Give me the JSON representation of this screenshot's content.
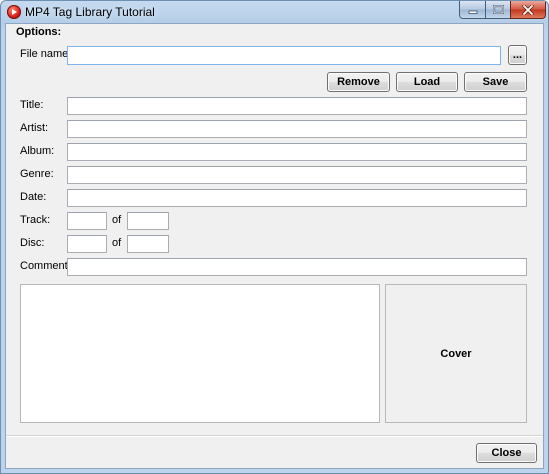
{
  "window": {
    "title": "MP4 Tag Library Tutorial",
    "minimize_icon": "minimize-icon",
    "maximize_icon": "maximize-icon",
    "close_icon": "close-icon"
  },
  "options": {
    "group_title": "Options:",
    "file_name_label": "File name:",
    "file_name_value": "",
    "browse_label": "...",
    "remove_label": "Remove",
    "load_label": "Load",
    "save_label": "Save"
  },
  "tags": {
    "title_label": "Title:",
    "title_value": "",
    "artist_label": "Artist:",
    "artist_value": "",
    "album_label": "Album:",
    "album_value": "",
    "genre_label": "Genre:",
    "genre_value": "",
    "date_label": "Date:",
    "date_value": "",
    "track_label": "Track:",
    "track_value": "",
    "track_of_label": "of",
    "track_total_value": "",
    "disc_label": "Disc:",
    "disc_value": "",
    "disc_of_label": "of",
    "disc_total_value": "",
    "comment_label": "Comment:",
    "comment_value": "",
    "lyrics_value": "",
    "cover_label": "Cover"
  },
  "footer": {
    "close_label": "Close"
  }
}
